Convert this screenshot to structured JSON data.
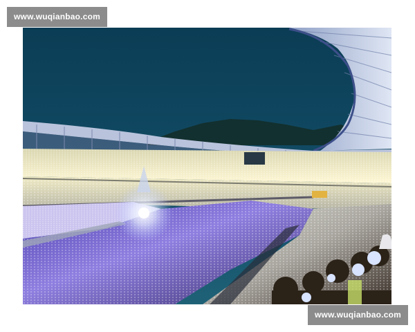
{
  "watermarks": {
    "top_left": "www.wuqianbao.com",
    "bottom_right": "www.wuqianbao.com"
  },
  "photo": {
    "subject": "stadium-concert-crowd-at-dusk",
    "colors": {
      "sky_top": "#0b3d55",
      "sky_bottom": "#1f6277",
      "hills": "#12302f",
      "roof": "#c7d2e8",
      "stand_lights": "#e9e6c2",
      "crowd_floor": "#6a4fc7",
      "stage_glow": "#ffffff"
    }
  }
}
